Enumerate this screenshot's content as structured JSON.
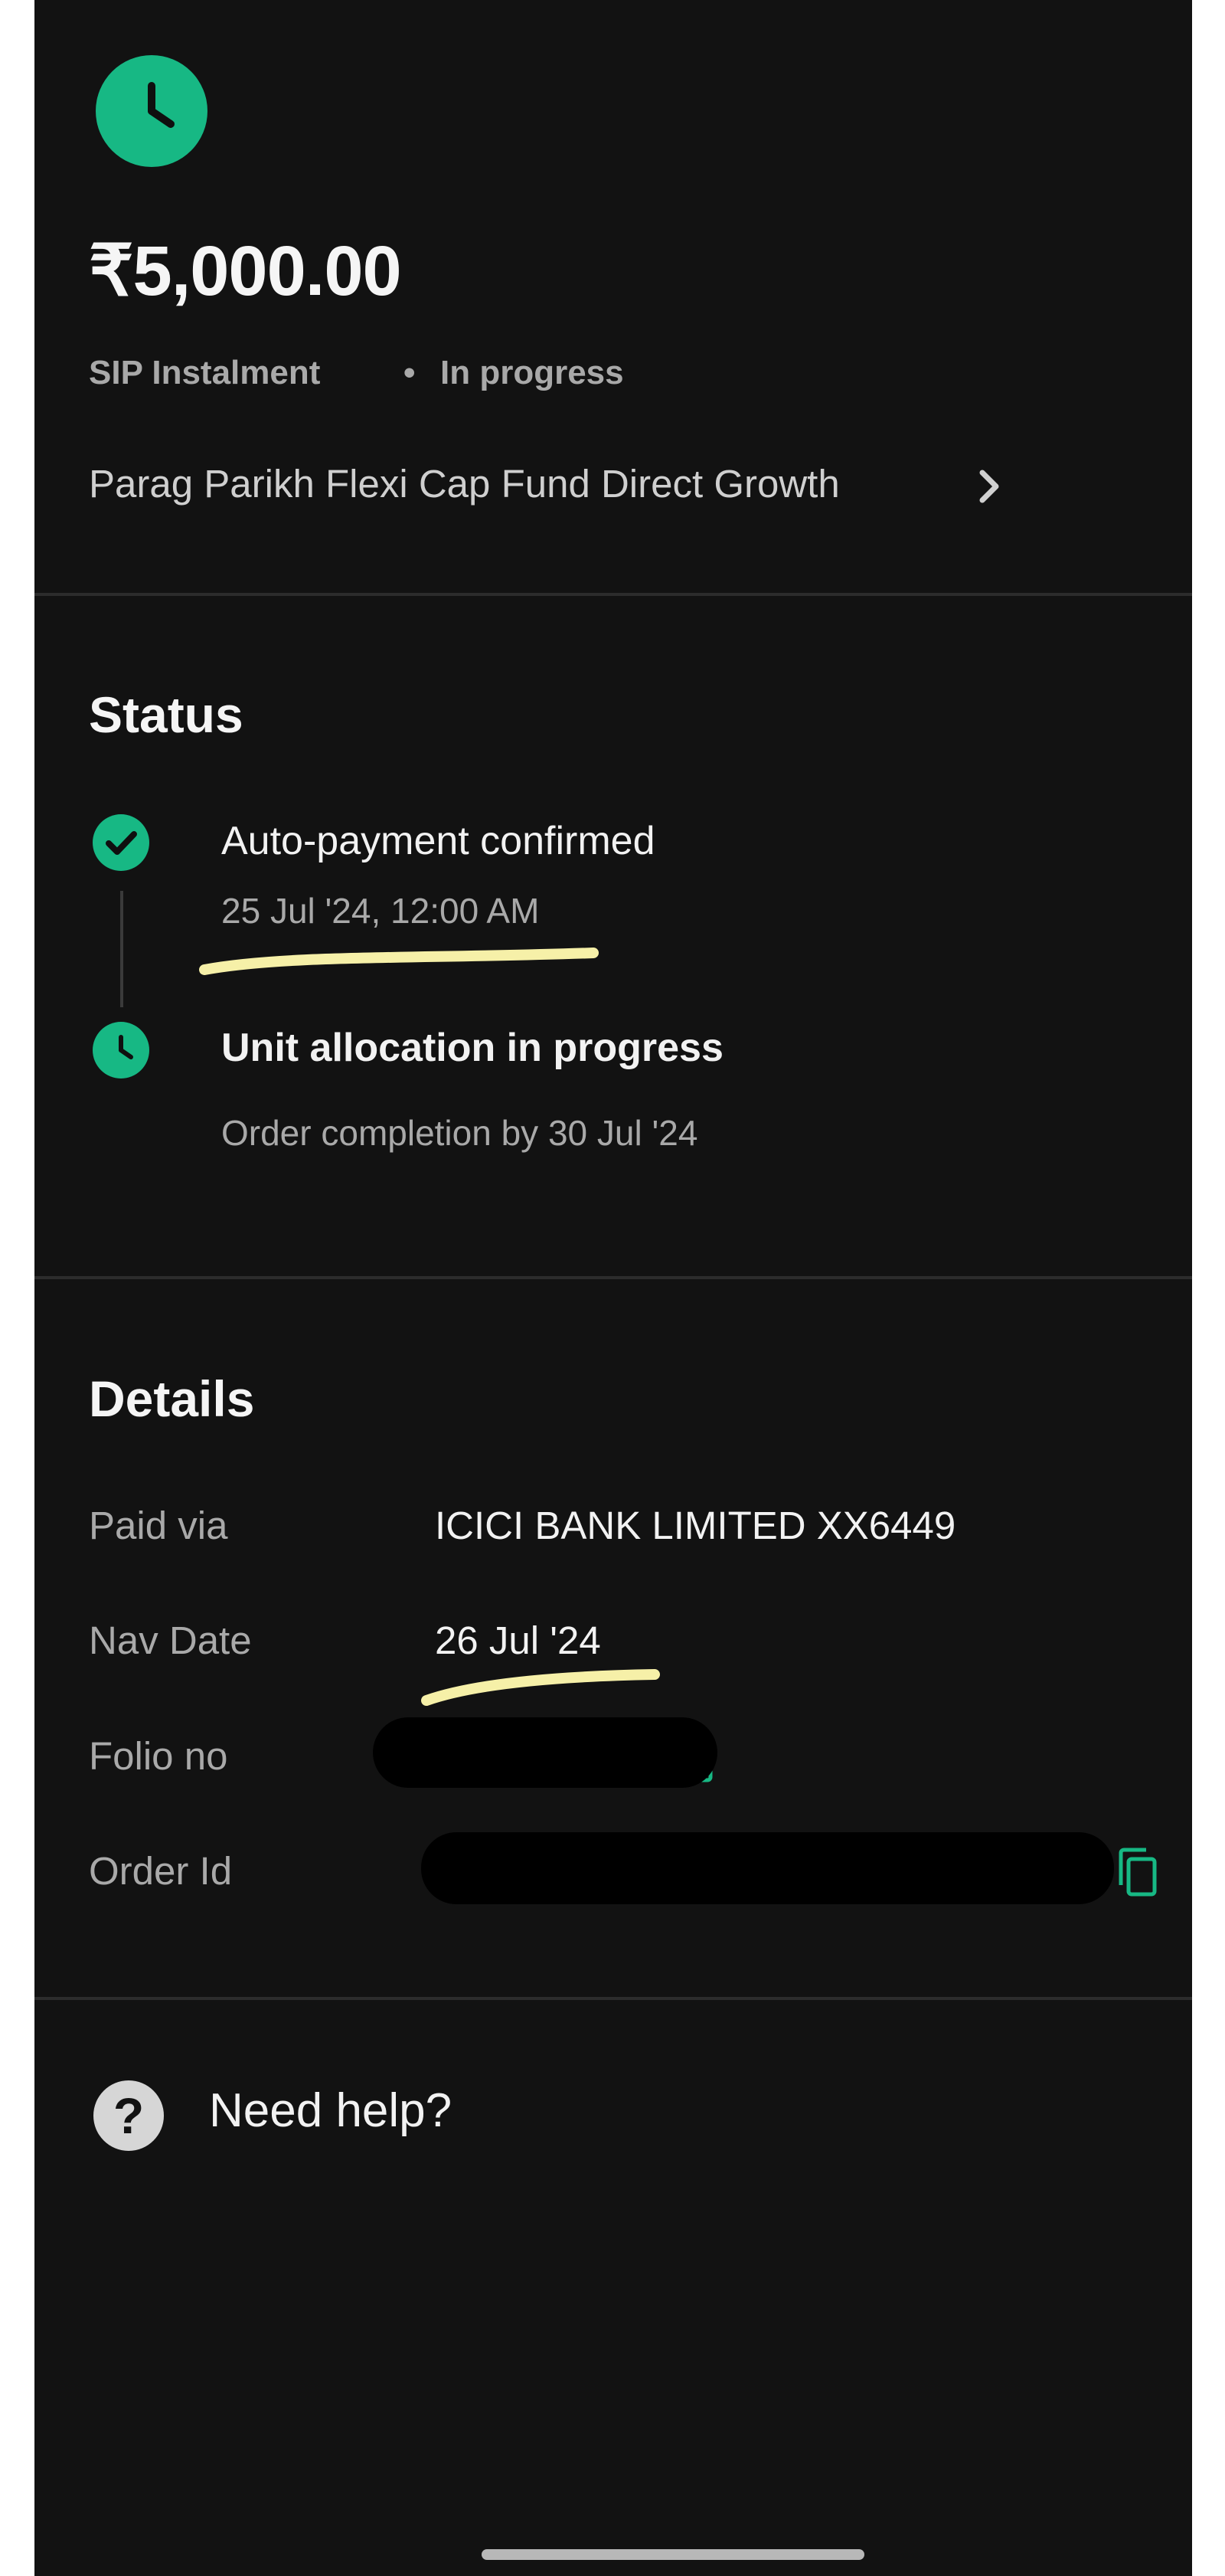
{
  "header": {
    "amount": "₹5,000.00",
    "type": "SIP Instalment",
    "separator": "•",
    "status": "In progress",
    "fund_name": "Parag Parikh Flexi Cap Fund Direct Growth",
    "icon": "clock-icon",
    "accent_color": "#17b884"
  },
  "status_section": {
    "title": "Status",
    "steps": [
      {
        "title": "Auto-payment confirmed",
        "subtitle": "25 Jul '24, 12:00 AM",
        "icon": "check-circle-icon"
      },
      {
        "title": "Unit allocation in progress",
        "subtitle": "Order completion by 30 Jul '24",
        "icon": "clock-icon"
      }
    ]
  },
  "details_section": {
    "title": "Details",
    "rows": [
      {
        "label": "Paid via",
        "value": "ICICI BANK LIMITED XX6449"
      },
      {
        "label": "Nav Date",
        "value": "26 Jul '24"
      },
      {
        "label": "Folio no",
        "value": ""
      },
      {
        "label": "Order Id",
        "value": ""
      }
    ]
  },
  "help": {
    "label": "Need help?",
    "icon": "help-circle-icon"
  }
}
